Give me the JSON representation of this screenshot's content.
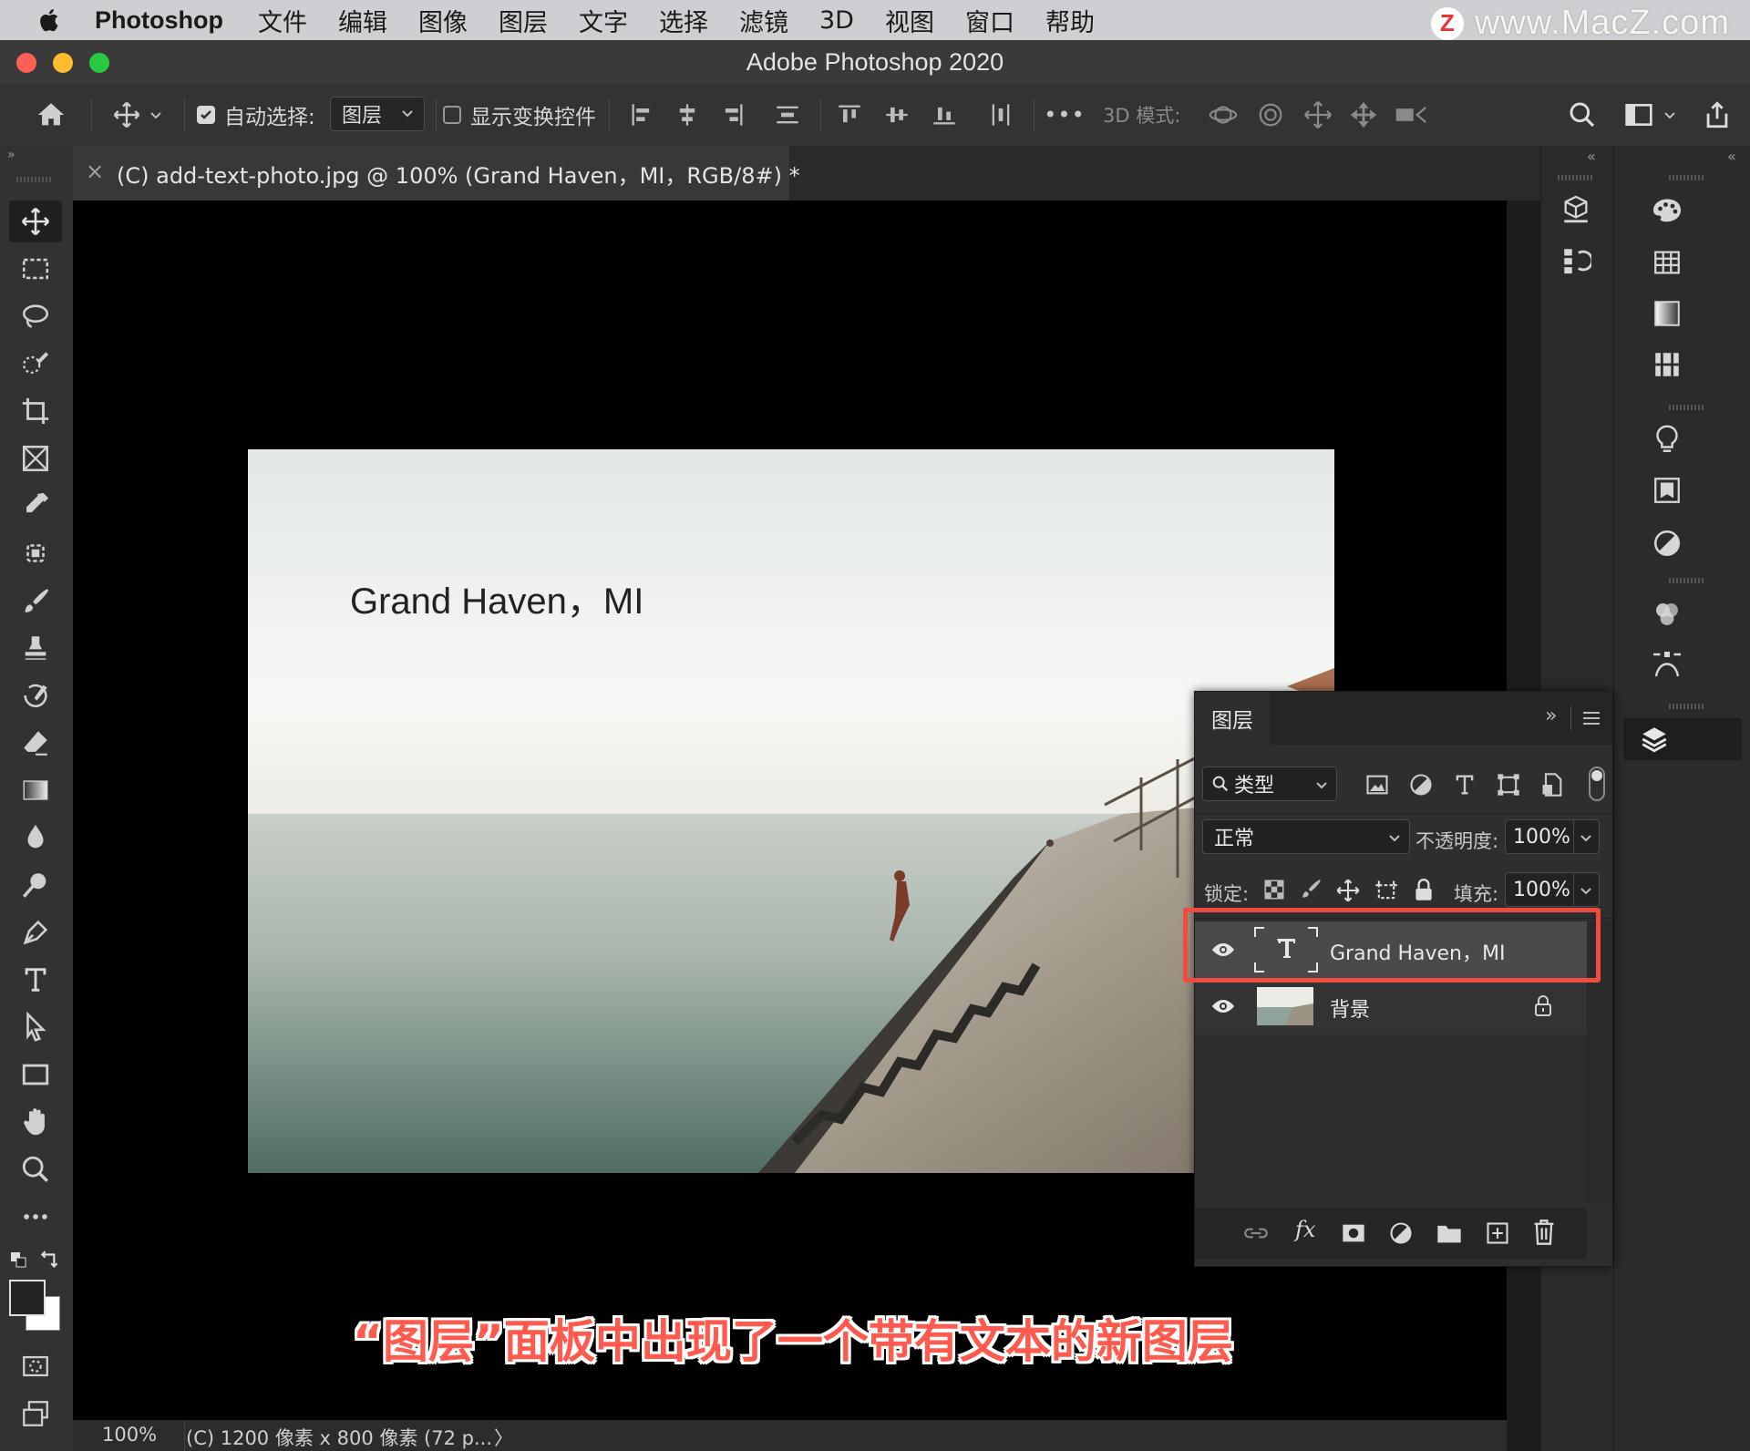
{
  "menubar": {
    "app_name": "Photoshop",
    "items": [
      "文件",
      "编辑",
      "图像",
      "图层",
      "文字",
      "选择",
      "滤镜",
      "3D",
      "视图",
      "窗口",
      "帮助"
    ]
  },
  "watermark": {
    "badge": "Z",
    "text": "www.MacZ.com"
  },
  "window": {
    "title": "Adobe Photoshop 2020"
  },
  "options_bar": {
    "auto_select_label": "自动选择:",
    "auto_select_checked": true,
    "auto_select_target": "图层",
    "show_transform_label": "显示变换控件",
    "show_transform_checked": false,
    "more": "•••",
    "mode_3d_label": "3D 模式:"
  },
  "document": {
    "tab_close": "×",
    "tab_label": "(C) add-text-photo.jpg @ 100% (Grand Haven，MI，RGB/8#) *",
    "photo_text": "Grand Haven，MI"
  },
  "caption": "“图层”面板中出现了一个带有文本的新图层",
  "status_bar": {
    "zoom": "100%",
    "info": "(C) 1200 像素 x 800 像素 (72 p...",
    "arrow": "〉"
  },
  "layers_panel": {
    "tab": "图层",
    "filter_label": "类型",
    "blend_mode": "正常",
    "opacity_label": "不透明度:",
    "opacity_value": "100%",
    "lock_label": "锁定:",
    "fill_label": "填充:",
    "fill_value": "100%",
    "layers": [
      {
        "name": "Grand Haven，MI",
        "type": "text",
        "visible": true,
        "selected": true
      },
      {
        "name": "背景",
        "type": "image",
        "visible": true,
        "locked": true
      }
    ]
  },
  "colors": {
    "highlight": "#ef4b3f",
    "caption": "#ff5a4e",
    "canvas": "#000000",
    "panel": "#2e2e2e"
  }
}
